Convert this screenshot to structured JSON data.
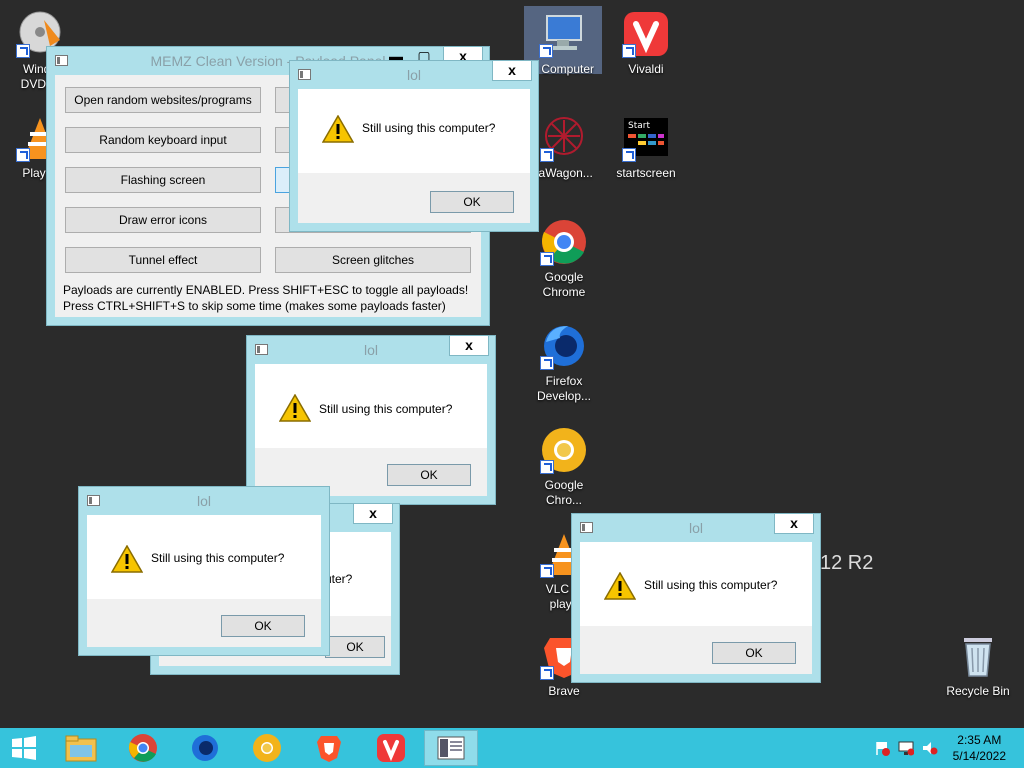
{
  "desktop": {
    "icons": [
      {
        "label": "Windows DVD Maker",
        "display": "Windo\nDVD M"
      },
      {
        "label": "Play D"
      },
      {
        "label": "My Computer",
        "display": "y Computer"
      },
      {
        "label": "Vivaldi"
      },
      {
        "label": "taWagon...",
        "display": "taWagon..."
      },
      {
        "label": "startscreen"
      },
      {
        "label": "Google Chrome"
      },
      {
        "label": "Firefox Develop..."
      },
      {
        "label": "Google Chro..."
      },
      {
        "label": "VLC m playe",
        "display": "VLC m\nplaye"
      },
      {
        "label": "Brave"
      },
      {
        "label": "Recycle Bin"
      }
    ],
    "watermark": "12 R2"
  },
  "memz_panel": {
    "title": "MEMZ Clean Version - Payload Panel",
    "buttons": [
      "Open random websites/programs",
      "Random keyboard input",
      "Flashing screen",
      "Draw error icons",
      "Tunnel effect",
      "Screen glitches"
    ],
    "note1": "Payloads are currently ENABLED. Press SHIFT+ESC to toggle all payloads!",
    "note2": "Press CTRL+SHIFT+S to skip some time (makes some payloads faster)"
  },
  "dialog": {
    "title": "lol",
    "message": "Still using this computer?",
    "partial_message": "uter?",
    "ok": "OK",
    "close": "x"
  },
  "taskbar": {
    "time": "2:35 AM",
    "date": "5/14/2022"
  },
  "colors": {
    "window_frame": "#aee0ea",
    "taskbar": "#36c3dc",
    "desktop": "#2b2b2b"
  }
}
